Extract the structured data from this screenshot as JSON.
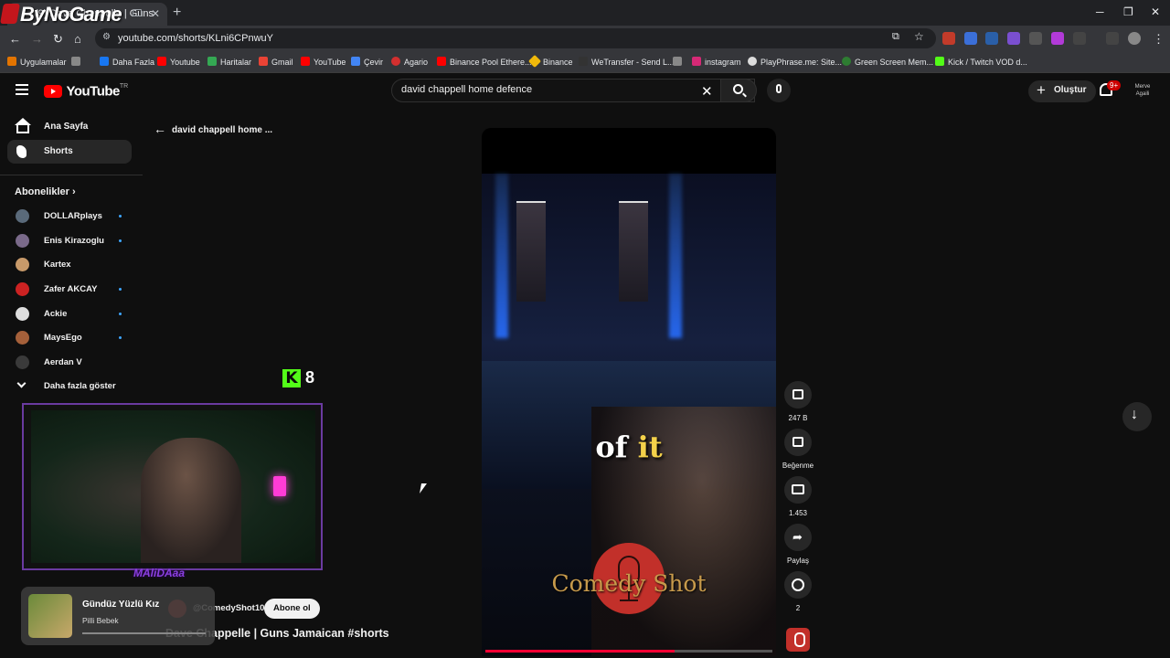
{
  "browser": {
    "brand": "ByNoGame",
    "tab_title": "(9) Dave Chappelle | Guns",
    "url": "youtube.com/shorts/KLni6CPnwuY",
    "bookmarks": [
      "Uygulamalar",
      "Daha Fazla",
      "Youtube",
      "Haritalar",
      "Gmail",
      "YouTube",
      "Çevir",
      "Agario",
      "Binance Pool Ethere...",
      "Binance",
      "WeTransfer - Send L...",
      "instagram",
      "PlayPhrase.me: Site...",
      "Green Screen Mem...",
      "Kick / Twitch VOD d..."
    ]
  },
  "masthead": {
    "logo": "YouTube",
    "country": "TR",
    "search_value": "david chappell home defence",
    "create_label": "Oluştur",
    "notif_count": "9+",
    "avatar_text": "Merve Agaili"
  },
  "sidebar": {
    "items": [
      {
        "label": "Ana Sayfa",
        "icon": "home-icon"
      },
      {
        "label": "Shorts",
        "icon": "shorts-icon"
      }
    ],
    "subscriptions_title": "Abonelikler",
    "subscriptions": [
      {
        "name": "DOLLARplays",
        "color": "#5a6a7a"
      },
      {
        "name": "Enis Kirazoglu",
        "color": "#7a6a8a"
      },
      {
        "name": "Kartex",
        "color": "#c89a6a"
      },
      {
        "name": "Zafer AKCAY",
        "color": "#cc2222"
      },
      {
        "name": "Ackie",
        "color": "#dddddd"
      },
      {
        "name": "MaysEgo",
        "color": "#a5603a"
      },
      {
        "name": "Aerdan V",
        "color": "#3a3a3a"
      }
    ],
    "show_more": "Daha fazla göster"
  },
  "shorts": {
    "back_label": "david chappell home ...",
    "caption_plain": "of ",
    "caption_highlight": "it",
    "watermark": "Comedy Shot",
    "channel_handle": "@ComedyShot10",
    "subscribe_label": "Abone ol",
    "title": "Dave Chappelle | Guns Jamaican #shorts",
    "progress": 0.66,
    "actions": {
      "likes": "247 B",
      "dislike_label": "Beğenme",
      "comments": "1.453",
      "share_label": "Paylaş",
      "remix_count": "2"
    }
  },
  "overlay": {
    "kick_count": "8",
    "streamer_name": "MAliDAaa",
    "music_title": "Gündüz Yüzlü Kız",
    "music_artist": "Pilli Bebek"
  },
  "colors": {
    "yt_red": "#ff0000",
    "kick_green": "#53fc18",
    "accent_purple": "#6a3aa0",
    "caption_yellow": "#f3d14a"
  }
}
